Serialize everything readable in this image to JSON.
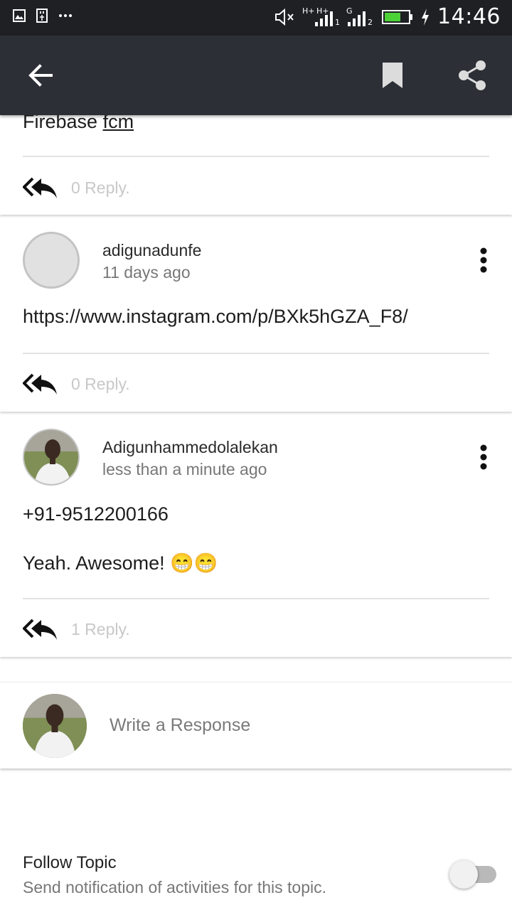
{
  "status_bar": {
    "time": "14:46",
    "network_1": "H+",
    "network_2": "H+",
    "network_3": "G",
    "sim_1": "1",
    "sim_2": "2"
  },
  "app_bar": {
    "back_icon": "arrow-left-icon",
    "bookmark_icon": "bookmark-icon",
    "share_icon": "share-icon"
  },
  "comments": [
    {
      "text_prefix": "Firebase ",
      "text_link": "fcm",
      "reply_label": "0 Reply."
    },
    {
      "username": "adigunadunfe",
      "time": "11 days ago",
      "text": "https://www.instagram.com/p/BXk5hGZA_F8/",
      "reply_label": "0 Reply."
    },
    {
      "username": "Adigunhammedolalekan",
      "time": "less than a minute ago",
      "line_1": "+91-9512200166",
      "line_2": "Yeah. Awesome! 😁😁",
      "reply_label": "1 Reply."
    }
  ],
  "response": {
    "placeholder": "Write a Response"
  },
  "follow": {
    "title": "Follow Topic",
    "subtitle": "Send notification of activities for this topic.",
    "enabled": false
  },
  "colors": {
    "app_bar": "#2c2f35",
    "status_bar": "#1e2024",
    "muted_text": "#777777"
  }
}
